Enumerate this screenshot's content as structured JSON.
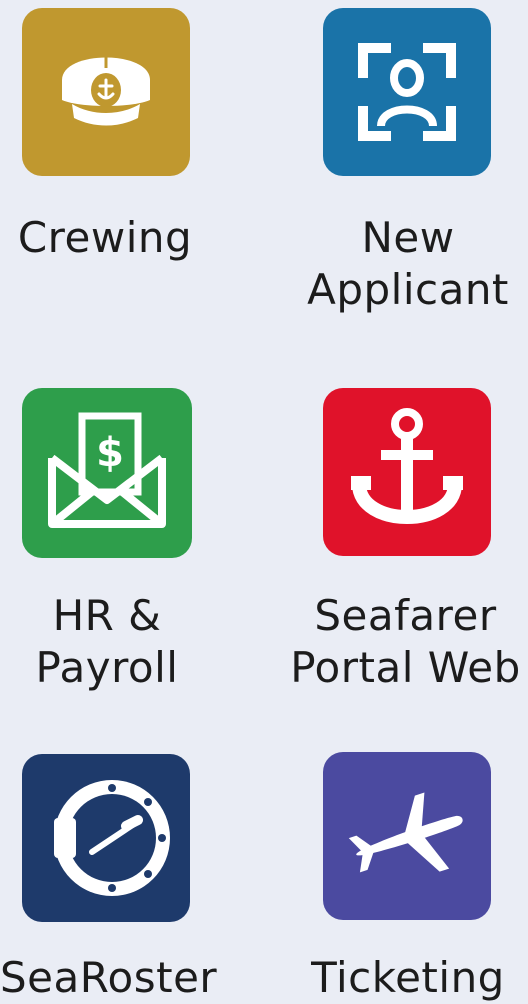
{
  "apps": [
    {
      "label": "Crewing",
      "icon": "captain-hat-icon",
      "color": "#c0982f"
    },
    {
      "label": "New\nApplicant",
      "icon": "face-scan-icon",
      "color": "#1a73a8"
    },
    {
      "label": "HR &\nPayroll",
      "icon": "envelope-dollar-icon",
      "color": "#2e9e4b"
    },
    {
      "label": "Seafarer\nPortal Web",
      "icon": "anchor-icon",
      "color": "#e0122a"
    },
    {
      "label": "SeaRoster",
      "icon": "porthole-gauge-icon",
      "color": "#1e3a6b"
    },
    {
      "label": "Ticketing",
      "icon": "airplane-icon",
      "color": "#4b4aa0"
    }
  ]
}
